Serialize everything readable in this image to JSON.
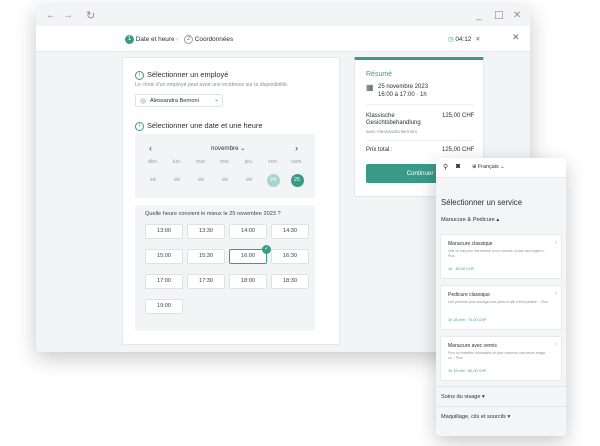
{
  "window": {
    "nav": {
      "back": "←",
      "forward": "→",
      "refresh": "↻"
    },
    "controls": {
      "minimize": "_",
      "maximize": "☐",
      "close": "✕"
    }
  },
  "stepbar": {
    "step1_num": "1",
    "step1_label": "Date et heure",
    "separator": "›",
    "step2_num": "2",
    "step2_label": "Coordonnées",
    "timer": "04:12",
    "timer_close": "✕",
    "close": "✕"
  },
  "employee": {
    "title": "Sélectionner un employé",
    "hint": "Le choix d'un employé peut avoir une incidence sur la disponibilité.",
    "selected": "Alessandra Bernoni"
  },
  "datetime": {
    "title": "Sélectionner une date et une heure",
    "month": "novembre",
    "weekdays": [
      "dim.",
      "lun.",
      "mar.",
      "mer.",
      "jeu.",
      "ven.",
      "sam."
    ],
    "days": [
      "19",
      "20",
      "21",
      "22",
      "23",
      "24",
      "25"
    ],
    "available_day": "24",
    "selected_day": "25",
    "question": "Quelle heure convient le mieux le 25 novembre 2023 ?",
    "slots": [
      "13:00",
      "13:30",
      "14:00",
      "14:30",
      "15:00",
      "15:30",
      "16:00",
      "16:30",
      "17:00",
      "17:30",
      "18:00",
      "18:30",
      "19:00"
    ],
    "selected_slot": "16:00"
  },
  "summary": {
    "title": "Résumé",
    "date": "25 novembre 2023",
    "time": "16:00 à 17:00 · 1h",
    "service_line1": "Klassische",
    "service_line2": "Gesichtsbehandlung",
    "with": "avec Alessandra Bernoni",
    "price": "125,00 CHF",
    "total_label": "Prix total :",
    "total": "125,00 CHF",
    "continue": "Continuer"
  },
  "mobile": {
    "language": "Français",
    "title": "Sélectionner un service",
    "category_open": "Manucure & Pedicure",
    "services": [
      {
        "name": "Manucure classique",
        "desc": "Que ce soit pour une femme ou un homme, la soin des ongles c… Plus",
        "meta": "1h · 80,00 CHF"
      },
      {
        "name": "Pedicure classique",
        "desc": "Une pédicure pour soulager vos pieds et afin d'être parfaite… Plus",
        "meta": "1h 15 min · 70,00 CHF"
      },
      {
        "name": "Manucure avec vernis",
        "desc": "Pour un entretien d'exception et pour renforcer une bonne image, ce… Plus",
        "meta": "1h 15 min · 60,00 CHF"
      }
    ],
    "category2": "Soins du visage",
    "category3": "Maquillage, cils et sourcils"
  },
  "colors": {
    "accent": "#3a9a88",
    "accent_light": "#a9d6cc"
  }
}
